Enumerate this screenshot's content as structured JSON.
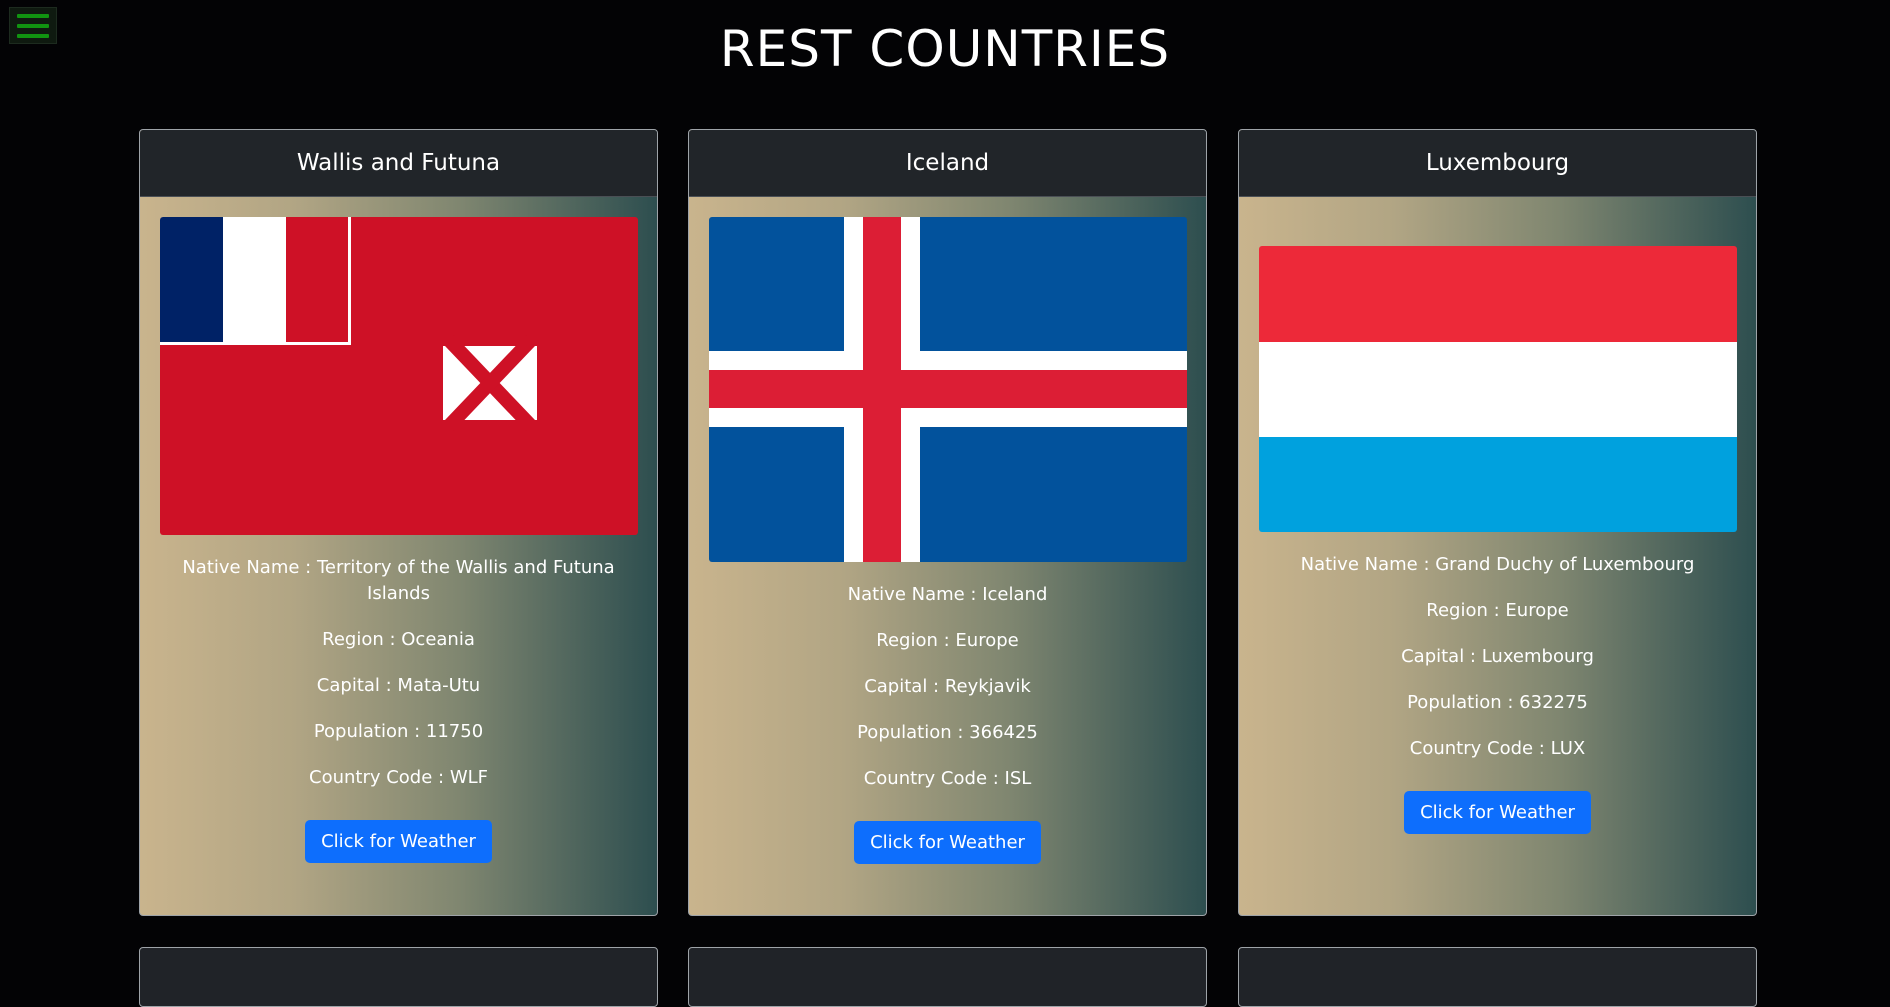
{
  "page": {
    "title": "REST COUNTRIES"
  },
  "cards": [
    {
      "name": "Wallis and Futuna",
      "native_name": "Native Name : Territory of the Wallis and Futuna Islands",
      "region": "Region : Oceania",
      "capital": "Capital : Mata-Utu",
      "population": "Population : 11750",
      "code": "Country Code : WLF",
      "button": "Click for Weather",
      "flag_colors": {
        "red": "#ce1126",
        "blue": "#002266",
        "white": "#ffffff"
      }
    },
    {
      "name": "Iceland",
      "native_name": "Native Name : Iceland",
      "region": "Region : Europe",
      "capital": "Capital : Reykjavik",
      "population": "Population : 366425",
      "code": "Country Code : ISL",
      "button": "Click for Weather",
      "flag_colors": {
        "blue": "#02529c",
        "white": "#ffffff",
        "red": "#dc1e35"
      }
    },
    {
      "name": "Luxembourg",
      "native_name": "Native Name : Grand Duchy of Luxembourg",
      "region": "Region : Europe",
      "capital": "Capital : Luxembourg",
      "population": "Population : 632275",
      "code": "Country Code : LUX",
      "button": "Click for Weather",
      "flag_colors": {
        "red": "#ed2939",
        "white": "#ffffff",
        "blue": "#00a1de"
      }
    }
  ],
  "icons": {
    "menu": "hamburger-menu-icon"
  },
  "colors": {
    "background": "#030305",
    "button": "#0d6efd",
    "menu_green": "#119411"
  }
}
